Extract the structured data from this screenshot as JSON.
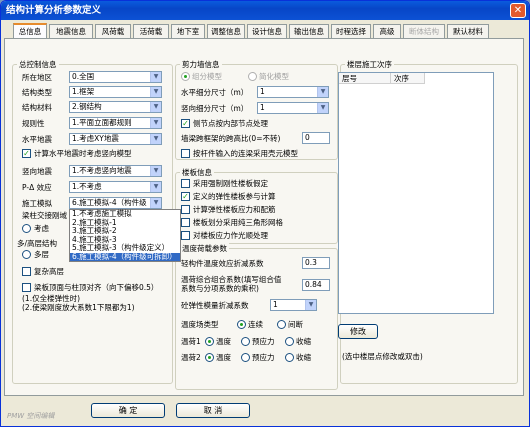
{
  "window": {
    "title": "结构计算分析参数定义",
    "close_symbol": "✕"
  },
  "tabs": [
    {
      "label": "总信息"
    },
    {
      "label": "地震信息"
    },
    {
      "label": "风荷载"
    },
    {
      "label": "活荷载"
    },
    {
      "label": "地下室"
    },
    {
      "label": "调整信息"
    },
    {
      "label": "设计信息"
    },
    {
      "label": "输出信息"
    },
    {
      "label": "时程选择"
    },
    {
      "label": "高级"
    },
    {
      "label": "断体结构"
    },
    {
      "label": "默认材料"
    }
  ],
  "general": {
    "group_title": "总控制信息",
    "region_label": "所在地区",
    "region_value": "0.全国",
    "structure_type_label": "结构类型",
    "structure_type_value": "1.框架",
    "material_label": "结构材料",
    "material_value": "2.钢结构",
    "regularity_label": "规则性",
    "regularity_value": "1.平面立面都规则",
    "horizontal_load_label": "水平地震",
    "horizontal_load_value": "1.考虑XY地震",
    "vertical_check_label": "计算水平地震时考虑竖向模型",
    "vertical_check_checked": true,
    "vertical_seismic_label": "竖向地震",
    "vertical_seismic_value": "1.不考虑竖向地震",
    "p_delta_label": "P-Δ 效应",
    "p_delta_value": "1.不考虑",
    "construction_label": "施工模拟",
    "construction_value": "6.施工模拟-4（构件级",
    "beam_label": "梁柱交接刚域",
    "consider_label": "考虑",
    "multi_layer_label": "多/高层结构",
    "multi_label": "多层",
    "complex_label": "复杂高层",
    "beam_top_label": "梁板顶面与柱顶对齐（向下偏移0.5）",
    "note1": "(1.仅全楼弹性时)",
    "note2": "(2.使梁刚度放大系数1下限都为1)",
    "construction_options": [
      "1.不考虑施工模拟",
      "2.施工模拟-1",
      "3.施工模拟-2",
      "4.施工模拟-3",
      "5.施工模拟-3（构件级定义）",
      "6.施工模拟-4（构件级可拆卸）"
    ],
    "construction_selected_index": 5
  },
  "shear_wall": {
    "group_title": "剪力墙信息",
    "radio_shell": "组分模型",
    "radio_simple": "简化模型",
    "h_size_label": "水平细分尺寸（m）",
    "h_size_value": "1",
    "v_size_label": "竖向细分尺寸（m）",
    "v_size_value": "1",
    "side_node_label": "侧节点按内部节点处理",
    "frame_span_label": "墙梁跨框架的跨高比(0=不转)",
    "frame_span_value": "0",
    "beam_strength_label": "按杆件输入的连梁采用壳元模型"
  },
  "floor": {
    "group_title": "楼板信息",
    "rigid_label": "采用强制刚性楼板假定",
    "elastic_label": "定义的弹性楼板参与计算",
    "calc_elastic_label": "计算弹性楼板应力和配筋",
    "triangle_label": "楼板划分采用纯三角形网格",
    "flexible_label": "对楼板应力作光顺处理"
  },
  "temperature": {
    "group_title": "温度荷载参数",
    "reduction_label": "轻构件温度效应折减系数",
    "reduction_value": "0.3",
    "combined_label_1": "温荷综合组合系数(填写组合值",
    "combined_label_2": "系数与分项系数的乘积)",
    "combined_value": "0.84",
    "rigid_beam_label": "砼弹性模量折减系数",
    "rigid_beam_value": "1",
    "field_type_label": "温度场类型",
    "field_continuous": "连续",
    "field_break": "间断",
    "case1_label": "温荷1",
    "case2_label": "温荷2",
    "opt_temp": "温度",
    "opt_pre": "预应力",
    "opt_shrink": "收缩"
  },
  "floor_order": {
    "group_title": "楼层施工次序",
    "col_layer": "层号",
    "col_order": "次序",
    "modify_button": "修改",
    "hint": "(选中楼层点修改或双击)"
  },
  "footer": {
    "ok": "确 定",
    "cancel": "取 消",
    "status": "PMW 空间编辑"
  }
}
